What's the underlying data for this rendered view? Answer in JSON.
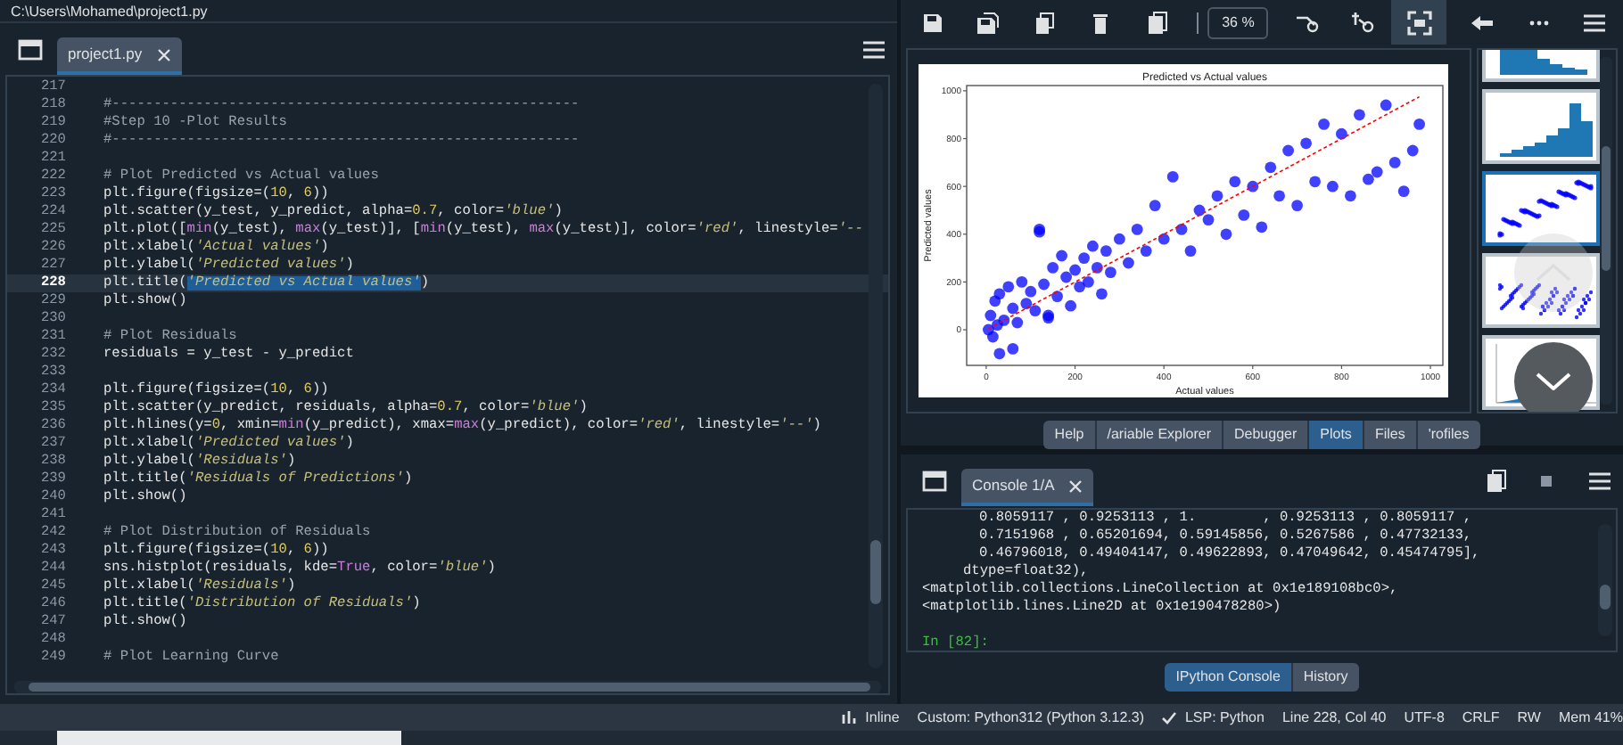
{
  "path_bar": {
    "text": "C:\\Users\\Mohamed\\project1.py"
  },
  "editor": {
    "tabs": [
      {
        "label": "project1.py",
        "selected": true
      }
    ],
    "lines": [
      {
        "number": "217",
        "current": false
      },
      {
        "number": "218",
        "code": "#--------------------------------------------------------",
        "current": false
      },
      {
        "number": "219",
        "code": "#Step 10 -Plot Results",
        "current": false
      },
      {
        "number": "220",
        "code": "#--------------------------------------------------------",
        "current": false
      },
      {
        "number": "221",
        "current": false
      },
      {
        "number": "222",
        "code": "# Plot Predicted vs Actual values",
        "current": false
      },
      {
        "number": "223",
        "code": "plt.figure(figsize=(10, 6))",
        "current": false
      },
      {
        "number": "224",
        "code": "plt.scatter(y_test, y_predict, alpha=0.7, color='blue')",
        "current": false
      },
      {
        "number": "225",
        "code": "plt.plot([min(y_test), max(y_test)], [min(y_test), max(y_test)], color='red', linestyle='--",
        "current": false
      },
      {
        "number": "226",
        "code": "plt.xlabel('Actual values')",
        "current": false
      },
      {
        "number": "227",
        "code": "plt.ylabel('Predicted values')",
        "current": false
      },
      {
        "number": "228",
        "code": "plt.title(",
        "selection": "'Predicted vs Actual values'",
        "code_after": ")",
        "current": true
      },
      {
        "number": "229",
        "code": "plt.show()",
        "current": false
      },
      {
        "number": "230",
        "current": false
      },
      {
        "number": "231",
        "code": "# Plot Residuals",
        "current": false
      },
      {
        "number": "232",
        "code": "residuals = y_test - y_predict",
        "current": false
      },
      {
        "number": "233",
        "current": false
      },
      {
        "number": "234",
        "code": "plt.figure(figsize=(10, 6))",
        "current": false
      },
      {
        "number": "235",
        "code": "plt.scatter(y_predict, residuals, alpha=0.7, color='blue')",
        "current": false
      },
      {
        "number": "236",
        "code": "plt.hlines(y=0, xmin=min(y_predict), xmax=max(y_predict), color='red', linestyle='--')",
        "current": false
      },
      {
        "number": "237",
        "code": "plt.xlabel('Predicted values')",
        "current": false
      },
      {
        "number": "238",
        "code": "plt.ylabel('Residuals')",
        "current": false
      },
      {
        "number": "239",
        "code": "plt.title('Residuals of Predictions')",
        "current": false
      },
      {
        "number": "240",
        "code": "plt.show()",
        "current": false
      },
      {
        "number": "241",
        "current": false
      },
      {
        "number": "242",
        "code": "# Plot Distribution of Residuals",
        "current": false
      },
      {
        "number": "243",
        "code": "plt.figure(figsize=(10, 6))",
        "current": false
      },
      {
        "number": "244",
        "code": "sns.histplot(residuals, kde=True, color='blue')",
        "current": false
      },
      {
        "number": "245",
        "code": "plt.xlabel('Residuals')",
        "current": false
      },
      {
        "number": "246",
        "code": "plt.title('Distribution of Residuals')",
        "current": false
      },
      {
        "number": "247",
        "code": "plt.show()",
        "current": false
      },
      {
        "number": "248",
        "current": false
      },
      {
        "number": "249",
        "code": "# Plot Learning Curve",
        "current": false
      }
    ]
  },
  "plots": {
    "toolbar": [
      {
        "kind": "save",
        "selected": false
      },
      {
        "kind": "save-all",
        "selected": false
      },
      {
        "kind": "copy",
        "selected": false
      },
      {
        "kind": "delete",
        "selected": false
      },
      {
        "kind": "delete-all",
        "selected": false
      },
      {
        "kind": "zoom",
        "value": "36 %"
      },
      {
        "kind": "zoom-out",
        "selected": false
      },
      {
        "kind": "zoom-in",
        "selected": false
      },
      {
        "kind": "fit",
        "selected": true
      },
      {
        "kind": "back",
        "selected": false
      },
      {
        "kind": "more",
        "selected": false
      },
      {
        "kind": "menu",
        "selected": false
      }
    ],
    "chart_data": {
      "type": "scatter",
      "title": "Predicted vs Actual values",
      "xlabel": "Actual values",
      "ylabel": "Predicted values",
      "xlim": [
        -44,
        1028
      ],
      "ylim": [
        -149,
        1022
      ],
      "xticks": [
        0,
        200,
        400,
        600,
        800,
        1000
      ],
      "yticks": [
        0,
        200,
        400,
        600,
        800,
        1000
      ],
      "x": [
        5,
        10,
        15,
        20,
        25,
        30,
        40,
        50,
        60,
        70,
        80,
        90,
        100,
        110,
        120,
        130,
        140,
        150,
        160,
        170,
        180,
        190,
        200,
        210,
        220,
        230,
        240,
        250,
        260,
        270,
        280,
        300,
        320,
        340,
        360,
        380,
        400,
        420,
        440,
        460,
        480,
        500,
        520,
        540,
        560,
        580,
        600,
        620,
        640,
        660,
        680,
        700,
        720,
        740,
        760,
        780,
        800,
        820,
        840,
        860,
        880,
        900,
        920,
        940,
        960,
        975,
        120,
        140,
        60,
        30
      ],
      "series": [
        {
          "color": "#0000ff",
          "values": [
            0,
            60,
            -30,
            120,
            20,
            150,
            40,
            180,
            90,
            30,
            200,
            110,
            160,
            80,
            410,
            190,
            60,
            260,
            140,
            310,
            220,
            100,
            250,
            180,
            300,
            200,
            350,
            260,
            150,
            330,
            240,
            380,
            280,
            420,
            330,
            520,
            380,
            640,
            420,
            330,
            500,
            460,
            560,
            400,
            620,
            480,
            600,
            430,
            680,
            560,
            750,
            520,
            780,
            620,
            860,
            600,
            820,
            560,
            900,
            630,
            660,
            940,
            700,
            580,
            750,
            860,
            420,
            50,
            -80,
            -100
          ]
        },
        {
          "type": "line",
          "line_style": "dashed",
          "color": "#ff0000",
          "values": [
            5,
            null,
            null,
            null,
            null,
            null,
            null,
            null,
            null,
            null,
            null,
            null,
            null,
            null,
            null,
            null,
            null,
            null,
            null,
            null,
            null,
            null,
            null,
            null,
            null,
            null,
            null,
            null,
            null,
            null,
            null,
            null,
            null,
            null,
            null,
            null,
            null,
            null,
            null,
            null,
            null,
            null,
            null,
            null,
            null,
            null,
            null,
            null,
            null,
            null,
            null,
            null,
            null,
            null,
            null,
            null,
            null,
            null,
            null,
            null,
            null,
            null,
            null,
            null,
            null,
            975,
            null,
            null,
            null,
            null
          ]
        }
      ]
    },
    "thumbnails": [
      {
        "kind": "decay",
        "selected": false
      },
      {
        "kind": "histogram",
        "selected": false
      },
      {
        "kind": "scatter",
        "selected": true
      },
      {
        "kind": "cloud",
        "selected": false
      },
      {
        "kind": "density",
        "selected": false
      }
    ],
    "tabs": [
      {
        "label": "Help",
        "selected": false
      },
      {
        "label": "/ariable Explorer",
        "selected": false
      },
      {
        "label": "Debugger",
        "selected": false
      },
      {
        "label": "Plots",
        "selected": true
      },
      {
        "label": "Files",
        "selected": false
      },
      {
        "label": "'rofiles",
        "selected": false
      }
    ]
  },
  "console": {
    "tabs": [
      {
        "label": "Console 1/A",
        "selected": true
      }
    ],
    "lines": [
      {
        "kind": "array",
        "text": "0.8059117 , 0.9253113 , 1.        , 0.9253113 , 0.8059117 ,"
      },
      {
        "kind": "array",
        "text": "0.7151968 , 0.65201694, 0.59145856, 0.5267586 , 0.47732133,"
      },
      {
        "kind": "array",
        "text": "0.46796018, 0.49404147, 0.49622893, 0.47049642, 0.45474795],"
      },
      {
        "kind": "dtype",
        "text": "dtype=float32),"
      },
      {
        "kind": "object",
        "text": "<matplotlib.collections.LineCollection at 0x1e189108bc0>,"
      },
      {
        "kind": "object",
        "text": "<matplotlib.lines.Line2D at 0x1e190478280>)"
      },
      {
        "kind": "prompt",
        "text": "In [82]:"
      }
    ],
    "pane_tabs": [
      {
        "label": "IPython Console",
        "selected": true
      },
      {
        "label": "History",
        "selected": false
      }
    ]
  },
  "status_bar": [
    {
      "kind": "inline",
      "text": "Inline"
    },
    {
      "kind": "plain",
      "text": "Custom: Python312 (Python 3.12.3)"
    },
    {
      "kind": "lsp",
      "text": "LSP: Python"
    },
    {
      "kind": "plain",
      "text": "Line 228, Col 40"
    },
    {
      "kind": "plain",
      "text": "UTF-8"
    },
    {
      "kind": "plain",
      "text": "CRLF"
    },
    {
      "kind": "plain",
      "text": "RW"
    },
    {
      "kind": "plain",
      "text": "Mem 41%"
    }
  ]
}
